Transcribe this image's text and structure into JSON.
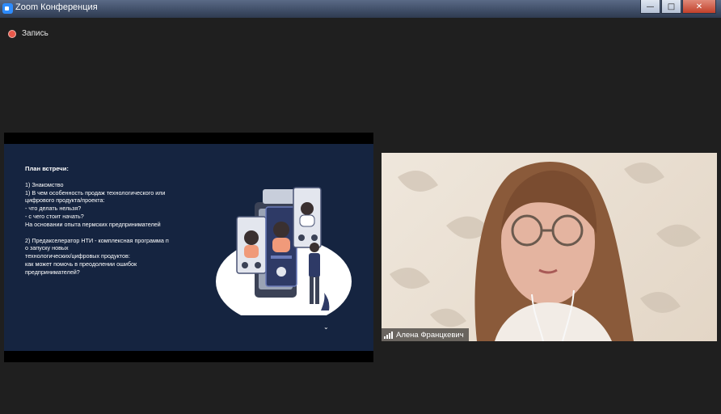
{
  "window": {
    "title": "Zoom Конференция"
  },
  "recording": {
    "label": "Запись"
  },
  "slide": {
    "heading": "План встречи:",
    "lines1": [
      "1) Знакомство",
      "1) В чем особенность продаж технологического или",
      "цифрового продукта/проекта:",
      "- что делать нельзя?",
      "- с чего стоит начать?",
      "На основании опыта пермских предпринимателей"
    ],
    "lines2": [
      "2) Предакселератор НТИ - комплексная программа п",
      "о запуску новых",
      "технологических/цифровых продуктов:",
      "как может помочь в преодолении ошибок",
      "предпринимателей?"
    ]
  },
  "participant": {
    "name": "Алена Францкевич"
  },
  "colors": {
    "slide_bg": "#152440",
    "record_red": "#e8584a",
    "zoom_blue": "#2d8cff"
  }
}
